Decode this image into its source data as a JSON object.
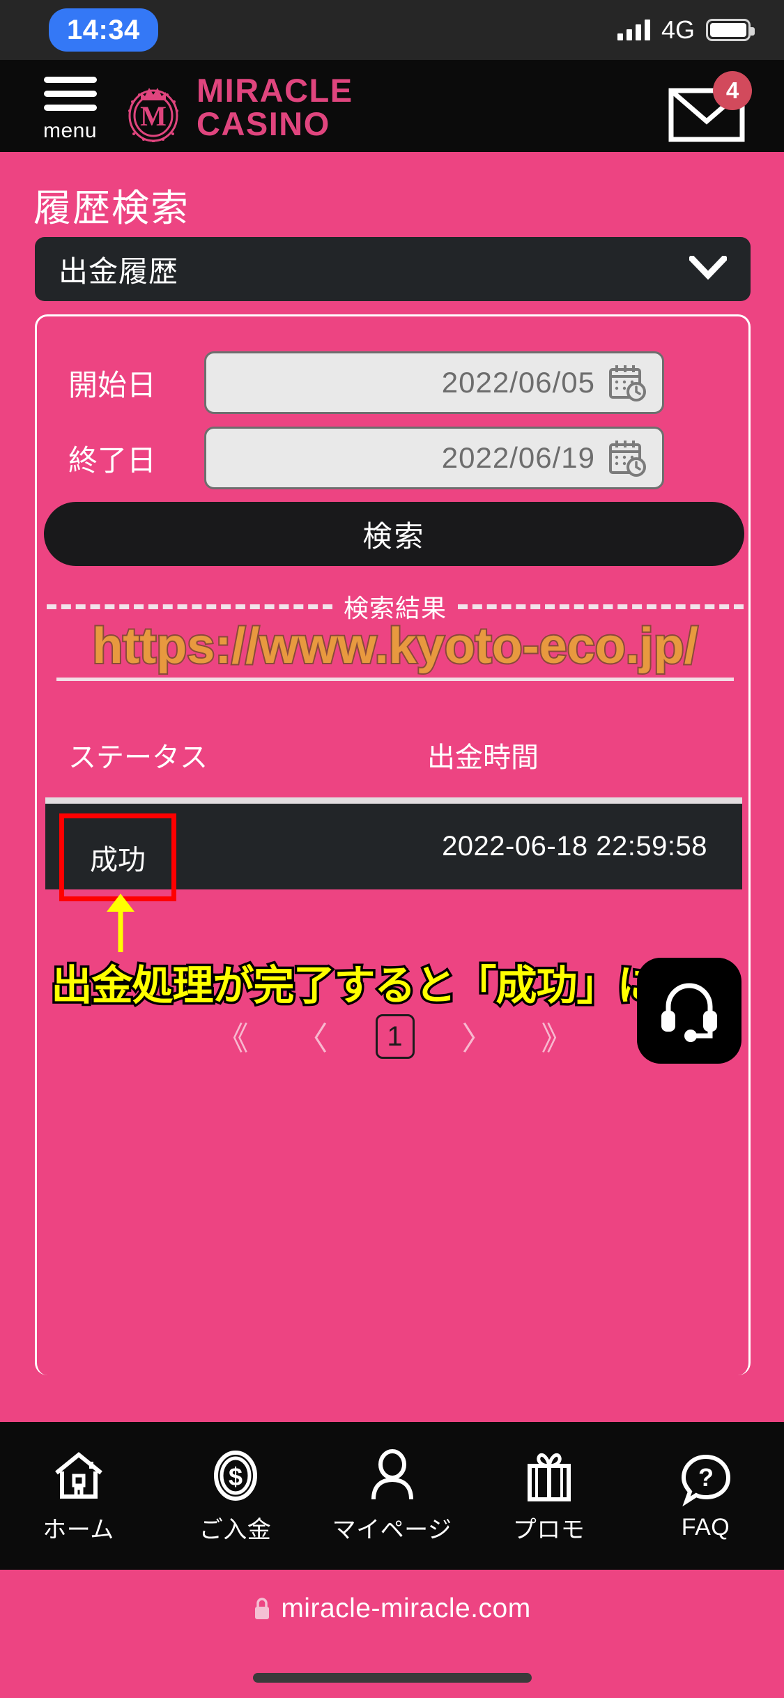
{
  "statusbar": {
    "time": "14:34",
    "network": "4G",
    "signal_icon": "signal-bars-icon",
    "battery_icon": "battery-icon"
  },
  "header": {
    "menu_label": "menu",
    "menu_icon": "hamburger-menu-icon",
    "logo_line1": "MIRACLE",
    "logo_line2": "CASINO",
    "logo_icon": "miracle-casino-crown-logo",
    "mail_icon": "envelope-icon",
    "mail_badge": "4",
    "brand_pink": "#e0457e",
    "badge_red": "#d24a5c"
  },
  "page": {
    "title": "履歴検索",
    "background": "#ed4482"
  },
  "history_type_select": {
    "value": "出金履歴",
    "chevron_icon": "chevron-down-icon"
  },
  "search_form": {
    "start_label": "開始日",
    "start_value": "2022/06/05",
    "end_label": "終了日",
    "end_value": "2022/06/19",
    "calendar_icon": "calendar-clock-icon",
    "search_button": "検索"
  },
  "results": {
    "divider_label": "検索結果",
    "watermark_url": "https://www.kyoto-eco.jp/",
    "watermark_color": "#e8993f",
    "columns": [
      "ステータス",
      "出金時間"
    ],
    "rows": [
      {
        "status": "成功",
        "time": "2022-06-18 22:59:58"
      }
    ],
    "highlight_color": "#ff0000"
  },
  "annotation": {
    "text": "出金処理が完了すると「成功」になる",
    "color": "#ffff00",
    "arrow_icon": "arrow-up-icon"
  },
  "pagination": {
    "first": "《",
    "prev": "〈",
    "current": "1",
    "next": "〉",
    "last": "》"
  },
  "support": {
    "icon": "headset-support-icon"
  },
  "bottom_nav": [
    {
      "label": "ホーム",
      "icon": "home-icon"
    },
    {
      "label": "ご入金",
      "icon": "coin-dollar-icon"
    },
    {
      "label": "マイページ",
      "icon": "person-icon"
    },
    {
      "label": "プロモ",
      "icon": "gift-icon"
    },
    {
      "label": "FAQ",
      "icon": "question-bubble-icon"
    }
  ],
  "browser": {
    "lock_icon": "lock-icon",
    "url": "miracle-miracle.com"
  }
}
